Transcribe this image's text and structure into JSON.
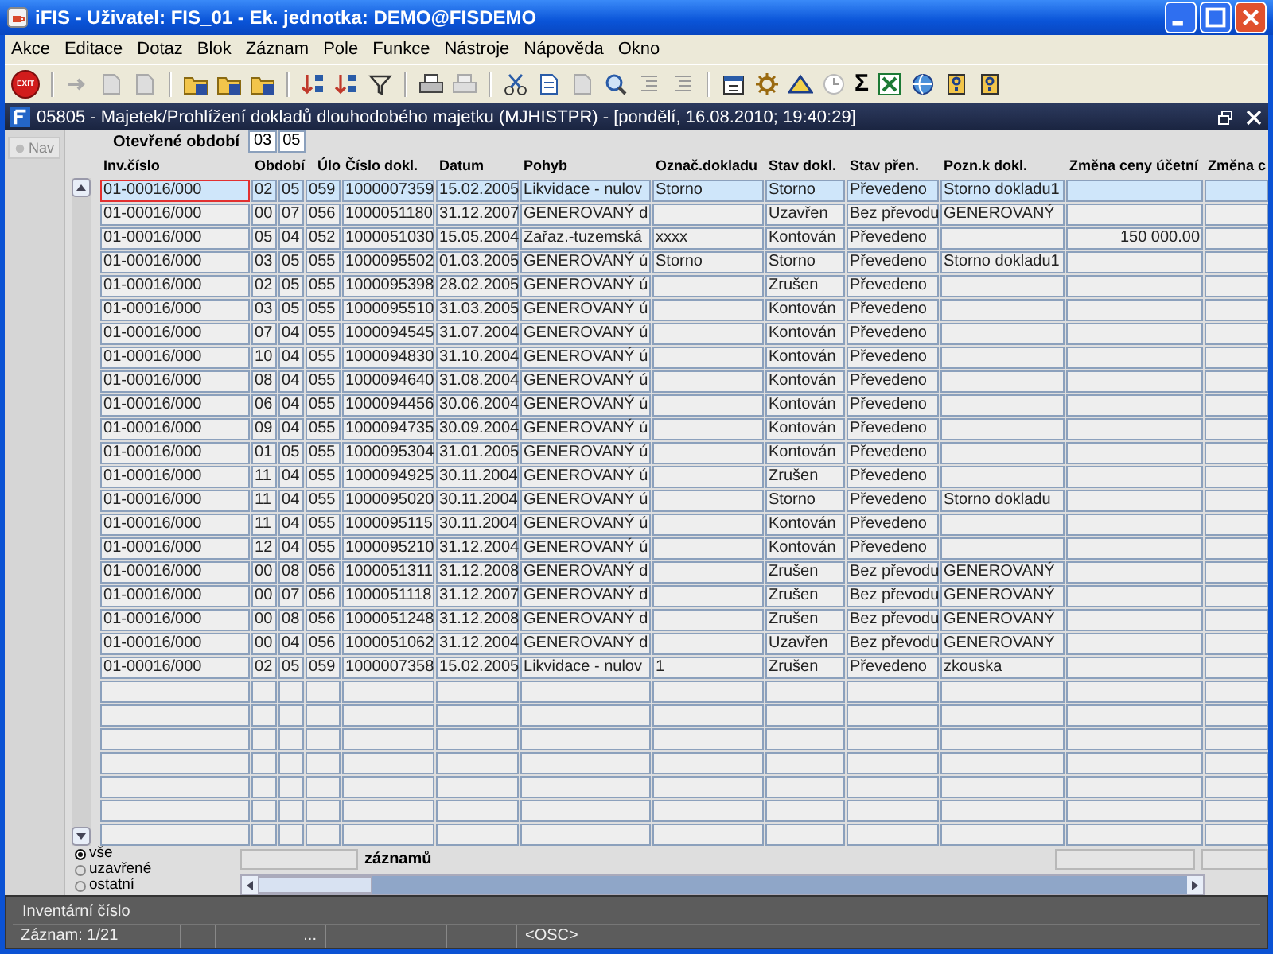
{
  "window": {
    "title": "iFIS - Uživatel: FIS_01 - Ek. jednotka: DEMO@FISDEMO"
  },
  "menu": [
    "Akce",
    "Editace",
    "Dotaz",
    "Blok",
    "Záznam",
    "Pole",
    "Funkce",
    "Nástroje",
    "Nápověda",
    "Okno"
  ],
  "toolbar": {
    "exit_label": "EXIT",
    "sigma": "Σ"
  },
  "form": {
    "title": "05805 - Majetek/Prohlížení dokladů  dlouhodobého majetku (MJHISTPR) - [pondělí, 16.08.2010; 19:40:29]"
  },
  "nav": {
    "label": "Nav"
  },
  "open_period": {
    "label": "Otevřené období",
    "values": [
      "03",
      "05"
    ]
  },
  "table": {
    "columns": [
      "Inv.číslo",
      "Období",
      "Úlo",
      "Číslo dokl.",
      "Datum",
      "Pohyb",
      "Označ.dokladu",
      "Stav dokl.",
      "Stav přen.",
      "Pozn.k dokl.",
      "Změna ceny účetní",
      "Změna c"
    ],
    "rows": [
      {
        "selected": true,
        "inv": "01-00016/000",
        "period": [
          "02",
          "05"
        ],
        "ledger": "059",
        "doc": "1000007359",
        "date": "15.02.2005",
        "movement": "Likvidace - nulov",
        "mark": "Storno",
        "doc_state": "Storno",
        "transfer_state": "Převedeno",
        "note": "Storno dokladu1"
      },
      {
        "selected": false,
        "inv": "01-00016/000",
        "period": [
          "00",
          "07"
        ],
        "ledger": "056",
        "doc": "1000051180",
        "date": "31.12.2007",
        "movement": "GENEROVANÝ d",
        "doc_state": "Uzavřen",
        "transfer_state": "Bez převodu",
        "note": "GENEROVANÝ"
      },
      {
        "selected": false,
        "inv": "01-00016/000",
        "period": [
          "05",
          "04"
        ],
        "ledger": "052",
        "doc": "1000051030",
        "date": "15.05.2004",
        "movement": "Zařaz.-tuzemská",
        "mark": "xxxx",
        "doc_state": "Kontován",
        "transfer_state": "Převedeno",
        "price_change": "150 000.00"
      },
      {
        "selected": false,
        "inv": "01-00016/000",
        "period": [
          "03",
          "05"
        ],
        "ledger": "055",
        "doc": "1000095502",
        "date": "01.03.2005",
        "movement": "GENEROVANÝ ú",
        "mark": "Storno",
        "doc_state": "Storno",
        "transfer_state": "Převedeno",
        "note": "Storno dokladu1"
      },
      {
        "selected": false,
        "inv": "01-00016/000",
        "period": [
          "02",
          "05"
        ],
        "ledger": "055",
        "doc": "1000095398",
        "date": "28.02.2005",
        "movement": "GENEROVANÝ ú",
        "doc_state": "Zrušen",
        "transfer_state": "Převedeno"
      },
      {
        "selected": false,
        "inv": "01-00016/000",
        "period": [
          "03",
          "05"
        ],
        "ledger": "055",
        "doc": "1000095510",
        "date": "31.03.2005",
        "movement": "GENEROVANÝ ú",
        "doc_state": "Kontován",
        "transfer_state": "Převedeno"
      },
      {
        "selected": false,
        "inv": "01-00016/000",
        "period": [
          "07",
          "04"
        ],
        "ledger": "055",
        "doc": "1000094545",
        "date": "31.07.2004",
        "movement": "GENEROVANÝ ú",
        "doc_state": "Kontován",
        "transfer_state": "Převedeno"
      },
      {
        "selected": false,
        "inv": "01-00016/000",
        "period": [
          "10",
          "04"
        ],
        "ledger": "055",
        "doc": "1000094830",
        "date": "31.10.2004",
        "movement": "GENEROVANÝ ú",
        "doc_state": "Kontován",
        "transfer_state": "Převedeno"
      },
      {
        "selected": false,
        "inv": "01-00016/000",
        "period": [
          "08",
          "04"
        ],
        "ledger": "055",
        "doc": "1000094640",
        "date": "31.08.2004",
        "movement": "GENEROVANÝ ú",
        "doc_state": "Kontován",
        "transfer_state": "Převedeno"
      },
      {
        "selected": false,
        "inv": "01-00016/000",
        "period": [
          "06",
          "04"
        ],
        "ledger": "055",
        "doc": "1000094456",
        "date": "30.06.2004",
        "movement": "GENEROVANÝ ú",
        "doc_state": "Kontován",
        "transfer_state": "Převedeno"
      },
      {
        "selected": false,
        "inv": "01-00016/000",
        "period": [
          "09",
          "04"
        ],
        "ledger": "055",
        "doc": "1000094735",
        "date": "30.09.2004",
        "movement": "GENEROVANÝ ú",
        "doc_state": "Kontován",
        "transfer_state": "Převedeno"
      },
      {
        "selected": false,
        "inv": "01-00016/000",
        "period": [
          "01",
          "05"
        ],
        "ledger": "055",
        "doc": "1000095304",
        "date": "31.01.2005",
        "movement": "GENEROVANÝ ú",
        "doc_state": "Kontován",
        "transfer_state": "Převedeno"
      },
      {
        "selected": false,
        "inv": "01-00016/000",
        "period": [
          "11",
          "04"
        ],
        "ledger": "055",
        "doc": "1000094925",
        "date": "30.11.2004",
        "movement": "GENEROVANÝ ú",
        "doc_state": "Zrušen",
        "transfer_state": "Převedeno"
      },
      {
        "selected": false,
        "inv": "01-00016/000",
        "period": [
          "11",
          "04"
        ],
        "ledger": "055",
        "doc": "1000095020",
        "date": "30.11.2004",
        "movement": "GENEROVANÝ ú",
        "doc_state": "Storno",
        "transfer_state": "Převedeno",
        "note": "Storno dokladu"
      },
      {
        "selected": false,
        "inv": "01-00016/000",
        "period": [
          "11",
          "04"
        ],
        "ledger": "055",
        "doc": "1000095115",
        "date": "30.11.2004",
        "movement": "GENEROVANÝ ú",
        "doc_state": "Kontován",
        "transfer_state": "Převedeno"
      },
      {
        "selected": false,
        "inv": "01-00016/000",
        "period": [
          "12",
          "04"
        ],
        "ledger": "055",
        "doc": "1000095210",
        "date": "31.12.2004",
        "movement": "GENEROVANÝ ú",
        "doc_state": "Kontován",
        "transfer_state": "Převedeno"
      },
      {
        "selected": false,
        "inv": "01-00016/000",
        "period": [
          "00",
          "08"
        ],
        "ledger": "056",
        "doc": "1000051311",
        "date": "31.12.2008",
        "movement": "GENEROVANÝ d",
        "doc_state": "Zrušen",
        "transfer_state": "Bez převodu",
        "note": "GENEROVANÝ"
      },
      {
        "selected": false,
        "inv": "01-00016/000",
        "period": [
          "00",
          "07"
        ],
        "ledger": "056",
        "doc": "1000051118",
        "date": "31.12.2007",
        "movement": "GENEROVANÝ d",
        "doc_state": "Zrušen",
        "transfer_state": "Bez převodu",
        "note": "GENEROVANÝ"
      },
      {
        "selected": false,
        "inv": "01-00016/000",
        "period": [
          "00",
          "08"
        ],
        "ledger": "056",
        "doc": "1000051248",
        "date": "31.12.2008",
        "movement": "GENEROVANÝ d",
        "doc_state": "Zrušen",
        "transfer_state": "Bez převodu",
        "note": "GENEROVANÝ"
      },
      {
        "selected": false,
        "inv": "01-00016/000",
        "period": [
          "00",
          "04"
        ],
        "ledger": "056",
        "doc": "1000051062",
        "date": "31.12.2004",
        "movement": "GENEROVANÝ d",
        "doc_state": "Uzavřen",
        "transfer_state": "Bez převodu",
        "note": "GENEROVANÝ"
      },
      {
        "selected": false,
        "inv": "01-00016/000",
        "period": [
          "02",
          "05"
        ],
        "ledger": "059",
        "doc": "1000007358",
        "date": "15.02.2005",
        "movement": "Likvidace - nulov",
        "mark": "1",
        "doc_state": "Zrušen",
        "transfer_state": "Převedeno",
        "note": "zkouska"
      }
    ]
  },
  "filter": [
    {
      "label": "vše",
      "selected": true
    },
    {
      "label": "uzavřené",
      "selected": false
    },
    {
      "label": "ostatní",
      "selected": false
    }
  ],
  "footer": {
    "count_label": "záznamů"
  },
  "status_bar": {
    "hint": "Inventární číslo",
    "record": "Záznam: 1/21",
    "segment": "...",
    "mode": "<OSC>"
  }
}
